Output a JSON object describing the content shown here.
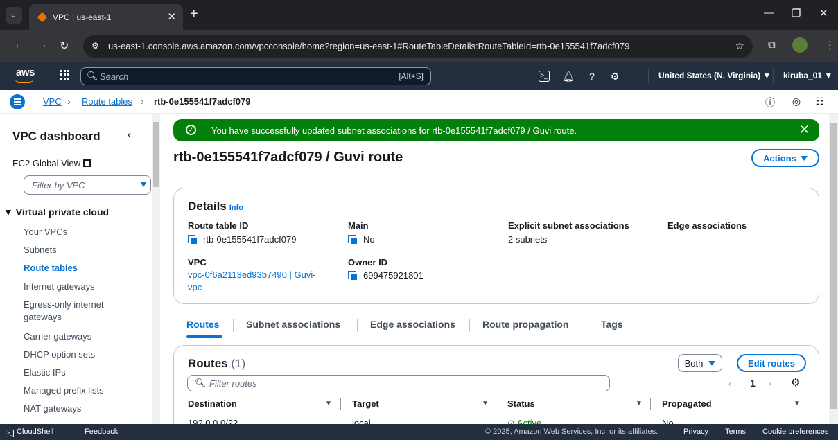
{
  "browser": {
    "tab_title": "VPC | us-east-1",
    "url": "us-east-1.console.aws.amazon.com/vpcconsole/home?region=us-east-1#RouteTableDetails:RouteTableId=rtb-0e155541f7adcf079"
  },
  "awsnav": {
    "logo": "aws",
    "search_placeholder": "Search",
    "search_shortcut": "[Alt+S]",
    "region": "United States (N. Virginia) ▼",
    "user": "kiruba_01 ▼"
  },
  "breadcrumb": {
    "items": [
      "VPC",
      "Route tables"
    ],
    "current": "rtb-0e155541f7adcf079"
  },
  "sidebar": {
    "title": "VPC dashboard",
    "ec2_global_view": "EC2 Global View",
    "filter_placeholder": "Filter by VPC",
    "section": "▼ Virtual private cloud",
    "items": [
      "Your VPCs",
      "Subnets",
      "Route tables",
      "Internet gateways",
      "Egress-only internet gateways",
      "Carrier gateways",
      "DHCP option sets",
      "Elastic IPs",
      "Managed prefix lists",
      "NAT gateways"
    ]
  },
  "flash": {
    "message": "You have successfully updated subnet associations for rtb-0e155541f7adcf079 / Guvi route."
  },
  "page": {
    "title": "rtb-0e155541f7adcf079 / Guvi route",
    "actions_label": "Actions"
  },
  "details": {
    "title": "Details",
    "info": "Info",
    "route_table_id_label": "Route table ID",
    "route_table_id": "rtb-0e155541f7adcf079",
    "main_label": "Main",
    "main": "No",
    "explicit_label": "Explicit subnet associations",
    "explicit": "2 subnets",
    "edge_label": "Edge associations",
    "edge": "–",
    "vpc_label": "VPC",
    "vpc_line1": "vpc-0f6a2113ed93b7490 | Guvi-",
    "vpc_line2": "vpc",
    "owner_label": "Owner ID",
    "owner": "699475921801"
  },
  "tabs": [
    "Routes",
    "Subnet associations",
    "Edge associations",
    "Route propagation",
    "Tags"
  ],
  "routes": {
    "title": "Routes",
    "count": "(1)",
    "both_label": "Both",
    "edit_label": "Edit routes",
    "filter_placeholder": "Filter routes",
    "page": "1",
    "columns": [
      "Destination",
      "Target",
      "Status",
      "Propagated"
    ],
    "rows": [
      {
        "destination": "192.0.0.0/22",
        "target": "local",
        "status": "Active",
        "propagated": "No"
      }
    ]
  },
  "footer": {
    "cloudshell": "CloudShell",
    "feedback": "Feedback",
    "copyright": "© 2025, Amazon Web Services, Inc. or its affiliates.",
    "privacy": "Privacy",
    "terms": "Terms",
    "cookies": "Cookie preferences"
  },
  "colors": {
    "aws_nav": "#232f3e",
    "link_blue": "#0972d3",
    "success_green": "#037f0c",
    "aws_orange": "#ff9900"
  }
}
